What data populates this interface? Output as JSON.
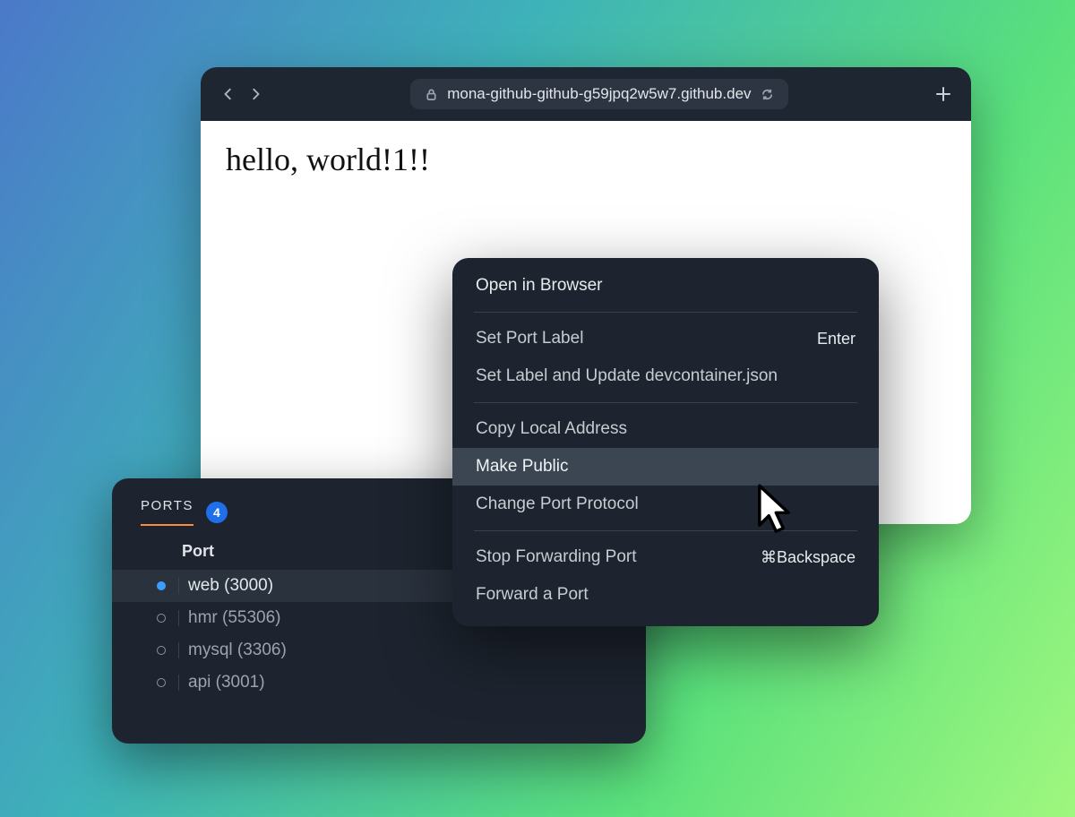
{
  "browser": {
    "url": "mona-github-github-g59jpq2w5w7.github.dev",
    "page_text": "hello, world!1!!"
  },
  "ports": {
    "tab_label": "PORTS",
    "badge_count": "4",
    "column_header": "Port",
    "items": [
      {
        "label": "web (3000)"
      },
      {
        "label": "hmr (55306)"
      },
      {
        "label": "mysql (3306)"
      },
      {
        "label": "api (3001)"
      }
    ]
  },
  "menu": {
    "open_in_browser": "Open in Browser",
    "set_port_label": "Set Port Label",
    "set_port_label_shortcut": "Enter",
    "set_label_update": "Set Label and Update devcontainer.json",
    "copy_local_address": "Copy Local Address",
    "make_public": "Make Public",
    "change_protocol": "Change Port Protocol",
    "stop_forwarding": "Stop Forwarding Port",
    "stop_forwarding_shortcut": "⌘Backspace",
    "forward_port": "Forward a Port"
  }
}
